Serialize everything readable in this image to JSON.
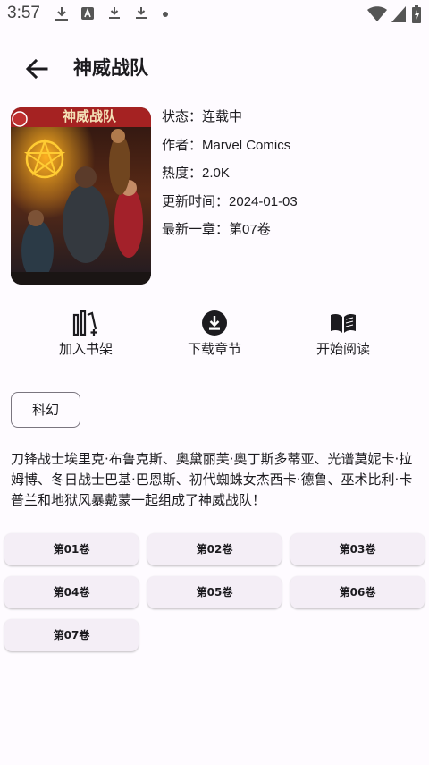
{
  "status_bar": {
    "time": "3:57",
    "icons": [
      "download-icon",
      "app-icon",
      "download-icon",
      "download-icon",
      "dot-icon",
      "wifi-icon",
      "signal-icon",
      "battery-icon"
    ]
  },
  "header": {
    "title": "神威战队",
    "back_icon": "back-arrow-icon"
  },
  "comic": {
    "cover_title": "神威战队",
    "info": [
      {
        "label": "状态：",
        "value": "连载中"
      },
      {
        "label": "作者：",
        "value": "Marvel Comics"
      },
      {
        "label": "热度：",
        "value": "2.0K"
      },
      {
        "label": "更新时间：",
        "value": "2024-01-03"
      },
      {
        "label": "最新一章：",
        "value": "第07卷"
      }
    ]
  },
  "actions": [
    {
      "label": "加入书架",
      "icon": "bookshelf-add-icon"
    },
    {
      "label": "下载章节",
      "icon": "download-circle-icon"
    },
    {
      "label": "开始阅读",
      "icon": "open-book-icon"
    }
  ],
  "tags": [
    "科幻"
  ],
  "description": "刀锋战士埃里克·布鲁克斯、奥黛丽芙·奥丁斯多蒂亚、光谱莫妮卡·拉姆博、冬日战士巴基·巴恩斯、初代蜘蛛女杰西卡·德鲁、巫术比利·卡普兰和地狱风暴戴蒙一起组成了神威战队！",
  "chapters": [
    "第01卷",
    "第02卷",
    "第03卷",
    "第04卷",
    "第05卷",
    "第06卷",
    "第07卷"
  ],
  "colors": {
    "background": "#fefbff",
    "chapter_button": "#f4eef6",
    "chip_border": "#7a757f"
  }
}
